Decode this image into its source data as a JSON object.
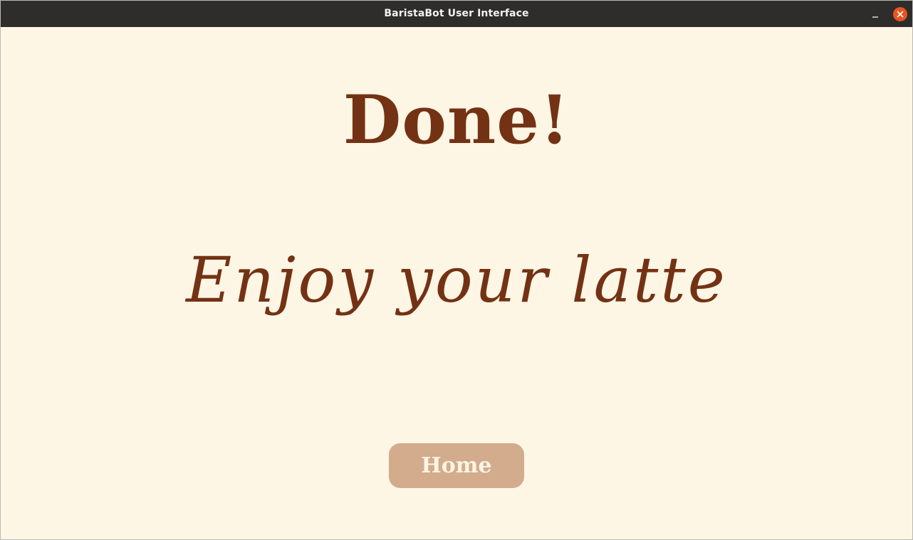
{
  "window": {
    "title": "BaristaBot User Interface",
    "minimize_icon": "minimize-icon",
    "close_icon": "close-icon",
    "close_color": "#e95420",
    "titlebar_color": "#2f2d2c"
  },
  "main": {
    "heading": "Done!",
    "message": "Enjoy your latte",
    "home_button_label": "Home"
  },
  "colors": {
    "background": "#fef6e4",
    "text": "#743214",
    "button": "#d2ac8c",
    "button_text": "#fdf4e4"
  }
}
